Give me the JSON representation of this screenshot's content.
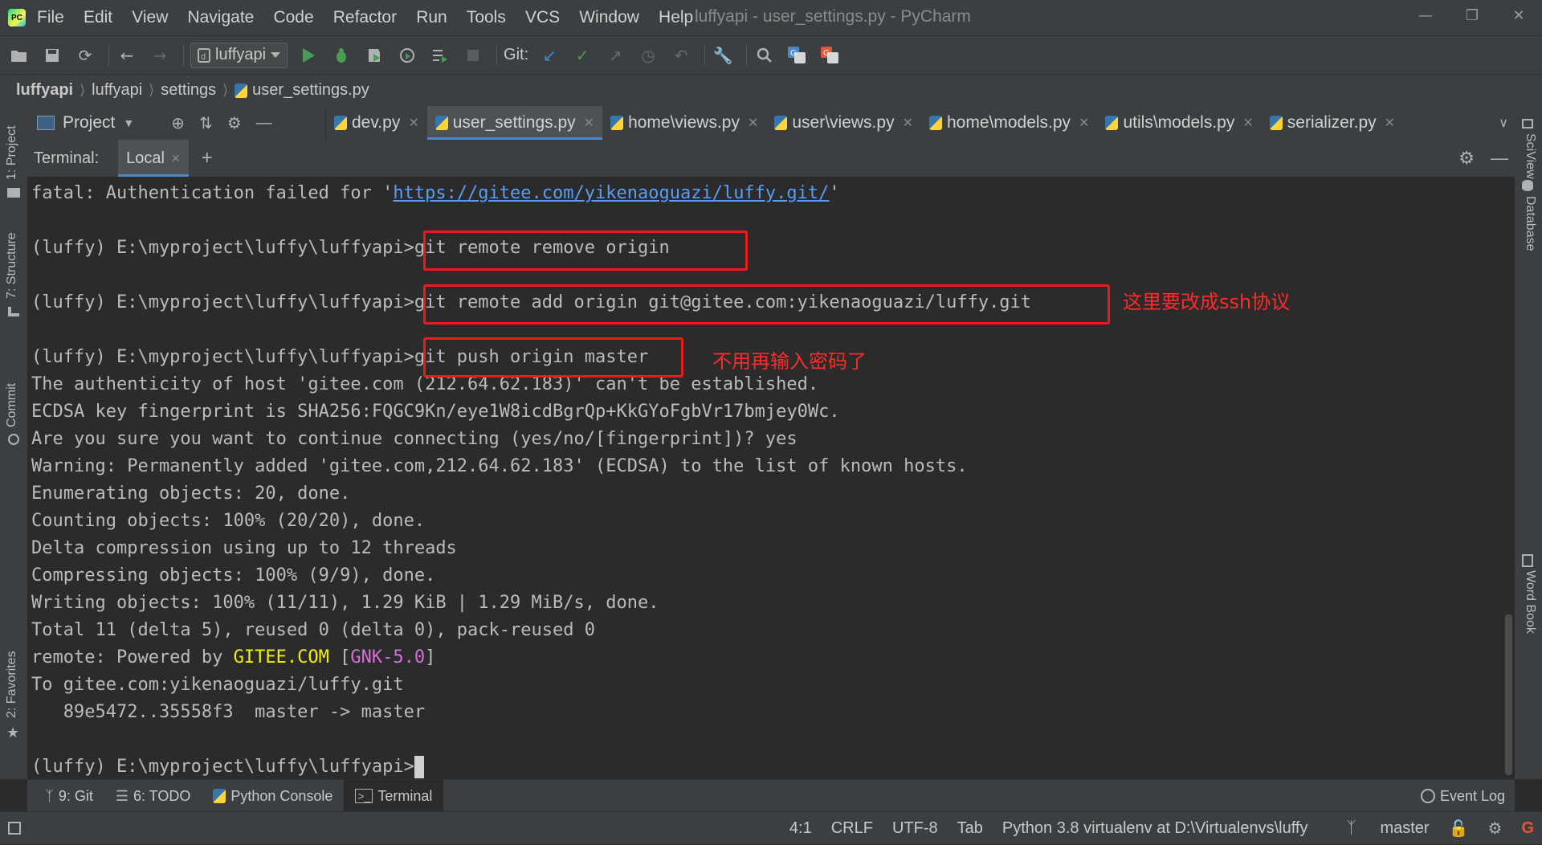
{
  "window": {
    "title": "luffyapi - user_settings.py - PyCharm",
    "logo_text": "PC",
    "menu": [
      "File",
      "Edit",
      "View",
      "Navigate",
      "Code",
      "Refactor",
      "Run",
      "Tools",
      "VCS",
      "Window",
      "Help"
    ]
  },
  "toolbar": {
    "run_config": "luffyapi",
    "git_label": "Git:"
  },
  "breadcrumb": [
    "luffyapi",
    "luffyapi",
    "settings",
    "user_settings.py"
  ],
  "left_panels": [
    "1: Project",
    "7: Structure",
    "Commit",
    "2: Favorites"
  ],
  "right_panels": [
    "SciView",
    "Database",
    "Word Book"
  ],
  "project_view": {
    "label": "Project"
  },
  "editor_tabs": [
    {
      "label": "dev.py",
      "active": false
    },
    {
      "label": "user_settings.py",
      "active": true
    },
    {
      "label": "home\\views.py",
      "active": false
    },
    {
      "label": "user\\views.py",
      "active": false
    },
    {
      "label": "home\\models.py",
      "active": false
    },
    {
      "label": "utils\\models.py",
      "active": false
    },
    {
      "label": "serializer.py",
      "active": false
    }
  ],
  "terminal": {
    "title": "Terminal:",
    "tab": "Local",
    "prompt": "(luffy) E:\\myproject\\luffy\\luffyapi>",
    "fatal_prefix": "fatal: Authentication failed for '",
    "fatal_url": "https://gitee.com/yikenaoguazi/luffy.git/",
    "fatal_suffix": "'",
    "cmd1": "git remote remove origin",
    "cmd2": "git remote add origin git@gitee.com:yikenaoguazi/luffy.git",
    "cmd3": "git push origin master",
    "output": [
      "The authenticity of host 'gitee.com (212.64.62.183)' can't be established.",
      "ECDSA key fingerprint is SHA256:FQGC9Kn/eye1W8icdBgrQp+KkGYoFgbVr17bmjey0Wc.",
      "Are you sure you want to continue connecting (yes/no/[fingerprint])? yes",
      "Warning: Permanently added 'gitee.com,212.64.62.183' (ECDSA) to the list of known hosts.",
      "Enumerating objects: 20, done.",
      "Counting objects: 100% (20/20), done.",
      "Delta compression using up to 12 threads",
      "Compressing objects: 100% (9/9), done.",
      "Writing objects: 100% (11/11), 1.29 KiB | 1.29 MiB/s, done.",
      "Total 11 (delta 5), reused 0 (delta 0), pack-reused 0"
    ],
    "remote_prefix": "remote: Powered by ",
    "remote_gitee": "GITEE.COM",
    "remote_open": " [",
    "remote_gnk": "GNK-5.0",
    "remote_close": "]",
    "to_line": "To gitee.com:yikenaoguazi/luffy.git",
    "ref_line": "   89e5472..35558f3  master -> master"
  },
  "annotations": {
    "ssh_note": "这里要改成ssh协议",
    "nopass_note": "不用再输入密码了",
    "color": "#ee1a1a"
  },
  "tool_windows": [
    {
      "label": "9: Git",
      "icon": "git-branch-icon"
    },
    {
      "label": "6: TODO",
      "icon": "list-icon"
    },
    {
      "label": "Python Console",
      "icon": "python-icon"
    },
    {
      "label": "Terminal",
      "icon": "terminal-icon",
      "active": true
    }
  ],
  "event_log": "Event Log",
  "status": {
    "position": "4:1",
    "line_sep": "CRLF",
    "encoding": "UTF-8",
    "indent": "Tab",
    "interpreter": "Python 3.8 virtualenv at D:\\Virtualenvs\\luffy",
    "branch": "master"
  }
}
